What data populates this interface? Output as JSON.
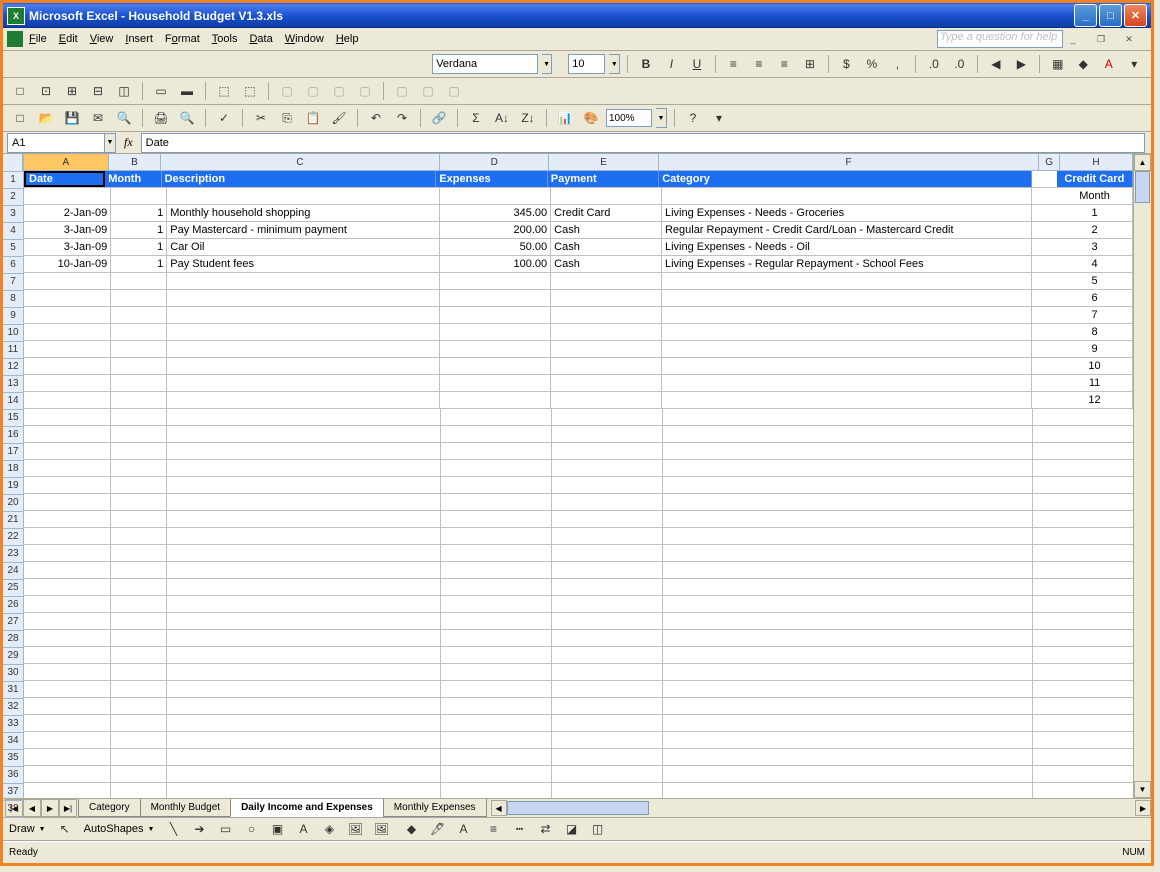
{
  "title": "Microsoft Excel - Household Budget V1.3.xls",
  "menu": {
    "file": "File",
    "edit": "Edit",
    "view": "View",
    "insert": "Insert",
    "format": "Format",
    "tools": "Tools",
    "data": "Data",
    "window": "Window",
    "help": "Help"
  },
  "askbox": "Type a question for help",
  "formatbar": {
    "font": "Verdana",
    "size": "10",
    "zoom": "100%"
  },
  "namebox": "A1",
  "formula": "Date",
  "columns": [
    "A",
    "B",
    "C",
    "D",
    "E",
    "F",
    "G",
    "H"
  ],
  "headers": {
    "A": "Date",
    "B": "Month",
    "C": "Description",
    "D": "Expenses",
    "E": "Payment",
    "F": "Category",
    "H": "Credit Card"
  },
  "rows": [
    {
      "A": "",
      "B": "",
      "C": "",
      "D": "",
      "E": "",
      "F": ""
    },
    {
      "A": "2-Jan-09",
      "B": "1",
      "C": "Monthly household shopping",
      "D": "345.00",
      "E": "Credit Card",
      "F": "Living Expenses - Needs - Groceries"
    },
    {
      "A": "3-Jan-09",
      "B": "1",
      "C": "Pay Mastercard - minimum payment",
      "D": "200.00",
      "E": "Cash",
      "F": "Regular Repayment - Credit Card/Loan - Mastercard Credit"
    },
    {
      "A": "3-Jan-09",
      "B": "1",
      "C": "Car Oil",
      "D": "50.00",
      "E": "Cash",
      "F": "Living Expenses - Needs - Oil"
    },
    {
      "A": "10-Jan-09",
      "B": "1",
      "C": "Pay Student fees",
      "D": "100.00",
      "E": "Cash",
      "F": "Living Expenses - Regular Repayment - School Fees"
    }
  ],
  "sideHeader": "Month",
  "sideValues": [
    "1",
    "2",
    "3",
    "4",
    "5",
    "6",
    "7",
    "8",
    "9",
    "10",
    "11",
    "12"
  ],
  "tabs": [
    "Category",
    "Monthly Budget",
    "Daily Income and Expenses",
    "Monthly Expenses"
  ],
  "activeTab": 2,
  "drawbar": {
    "draw": "Draw",
    "autoshapes": "AutoShapes"
  },
  "status": {
    "ready": "Ready",
    "num": "NUM"
  }
}
